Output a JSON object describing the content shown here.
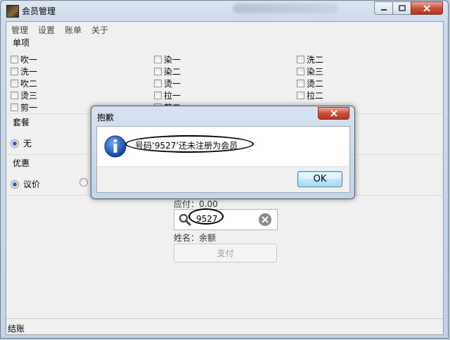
{
  "window": {
    "title": "会员管理"
  },
  "menu": [
    "管理",
    "设置",
    "账单",
    "关于"
  ],
  "items_section": {
    "label": "单项",
    "col1": [
      "吹一",
      "洗一",
      "吹二",
      "烫三",
      "剪一"
    ],
    "col2": [
      "染一",
      "染二",
      "烫一",
      "拉一",
      "剪二"
    ],
    "col3": [
      "洗二",
      "染三",
      "烫二",
      "拉二"
    ]
  },
  "package_section": {
    "label": "套餐",
    "selected": "无"
  },
  "discount_section": {
    "label": "优惠",
    "selected": "议价"
  },
  "payment": {
    "amount_due_label": "应付：0.00",
    "search_value": "9527",
    "name_balance_label": "姓名：余额",
    "pay_button": "支付"
  },
  "status_bar": {
    "text": "结账"
  },
  "dialog": {
    "title": "抱歉",
    "message": "号码‘9527’还未注册为会员",
    "ok_button": "OK",
    "icon": "info-icon"
  },
  "colors": {
    "accent": "#1e64c8",
    "close_red": "#c9503b"
  }
}
